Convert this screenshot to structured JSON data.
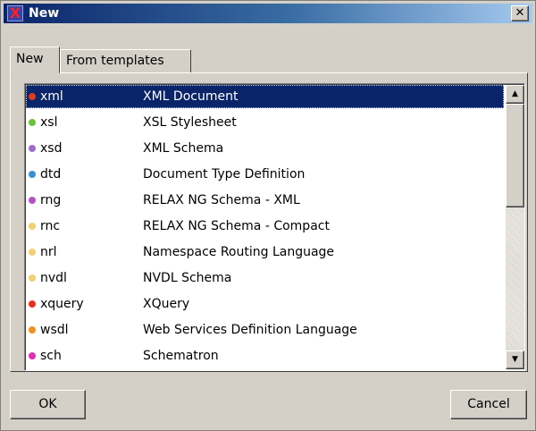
{
  "window": {
    "title": "New",
    "app_icon": "x-icon",
    "close_glyph": "✕"
  },
  "tabs": [
    {
      "label": "New",
      "active": true
    },
    {
      "label": "From templates",
      "active": false
    }
  ],
  "list": {
    "selected_index": 0,
    "items": [
      {
        "ext": "xml",
        "desc": "XML Document",
        "color": "#e03a1e"
      },
      {
        "ext": "xsl",
        "desc": "XSL Stylesheet",
        "color": "#6cc33a"
      },
      {
        "ext": "xsd",
        "desc": "XML Schema",
        "color": "#a06cc8"
      },
      {
        "ext": "dtd",
        "desc": "Document Type Definition",
        "color": "#3a8fd0"
      },
      {
        "ext": "rng",
        "desc": "RELAX NG Schema - XML",
        "color": "#b650c8"
      },
      {
        "ext": "rnc",
        "desc": "RELAX NG Schema - Compact",
        "color": "#f0d070"
      },
      {
        "ext": "nrl",
        "desc": "Namespace Routing Language",
        "color": "#f0d070"
      },
      {
        "ext": "nvdl",
        "desc": "NVDL Schema",
        "color": "#f0d070"
      },
      {
        "ext": "xquery",
        "desc": "XQuery",
        "color": "#e83020"
      },
      {
        "ext": "wsdl",
        "desc": "Web Services Definition Language",
        "color": "#f09020"
      },
      {
        "ext": "sch",
        "desc": "Schematron",
        "color": "#e030b0"
      }
    ]
  },
  "scrollbar": {
    "up_glyph": "▲",
    "down_glyph": "▼"
  },
  "buttons": {
    "ok": "OK",
    "cancel": "Cancel"
  },
  "colors": {
    "titlebar_start": "#0a246a",
    "selection": "#0a246a",
    "dialog_bg": "#d4d0c8"
  }
}
